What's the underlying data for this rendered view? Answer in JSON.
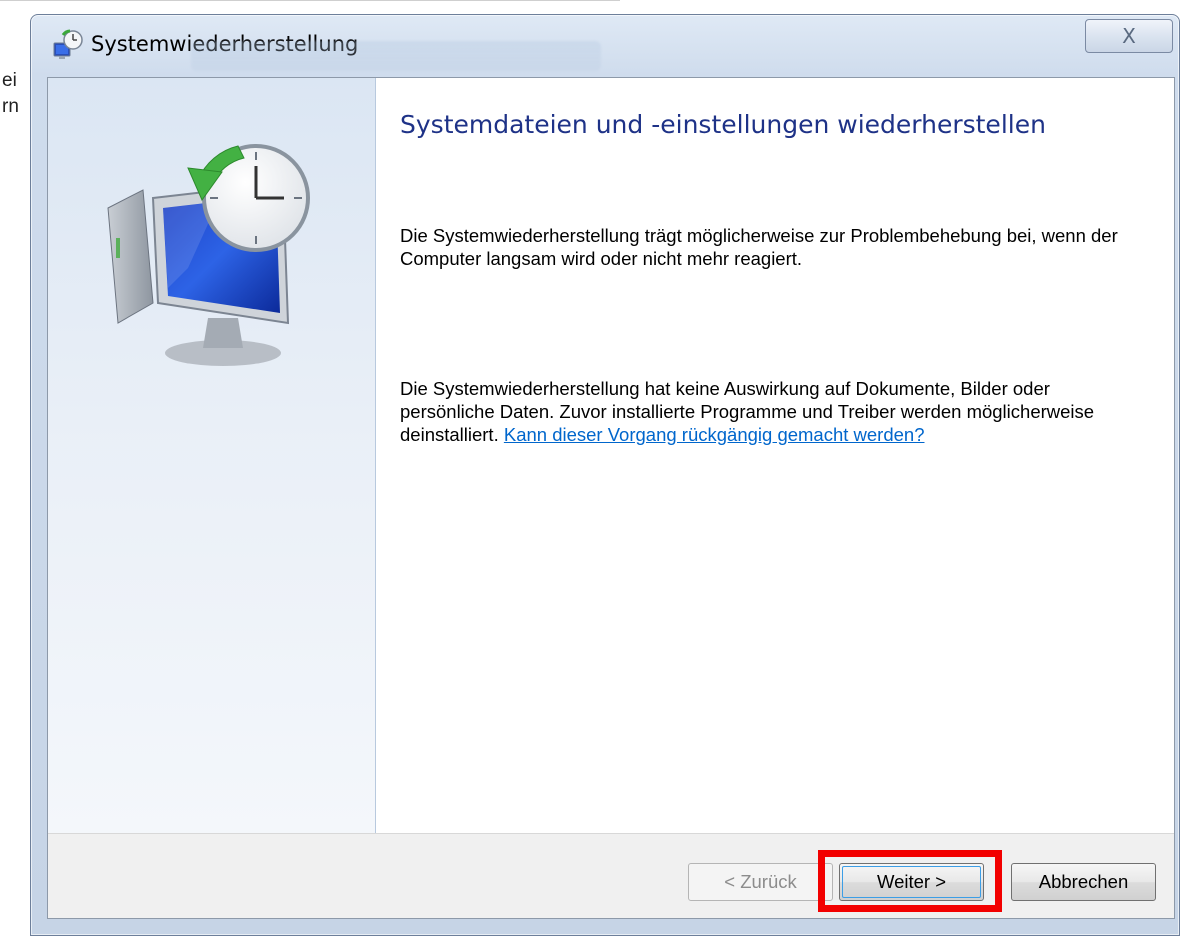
{
  "background_window": {
    "fragment_1": "ei",
    "fragment_2": "rn"
  },
  "window": {
    "title": "Systemwiederherstellung",
    "close_label": "X"
  },
  "content": {
    "heading": "Systemdateien und -einstellungen wiederherstellen",
    "paragraph_1": "Die Systemwiederherstellung trägt möglicherweise zur Problembehebung bei, wenn der Computer langsam wird oder nicht mehr reagiert.",
    "paragraph_2": "Die Systemwiederherstellung hat keine Auswirkung auf Dokumente, Bilder oder persönliche Daten. Zuvor installierte Programme und Treiber werden möglicherweise deinstalliert.",
    "link_text": "Kann dieser Vorgang rückgängig gemacht werden?"
  },
  "footer": {
    "back_label": "< Zurück",
    "next_label": "Weiter >",
    "cancel_label": "Abbrechen"
  },
  "colors": {
    "heading": "#1e3287",
    "link": "#0066cc",
    "highlight": "#f20000"
  }
}
